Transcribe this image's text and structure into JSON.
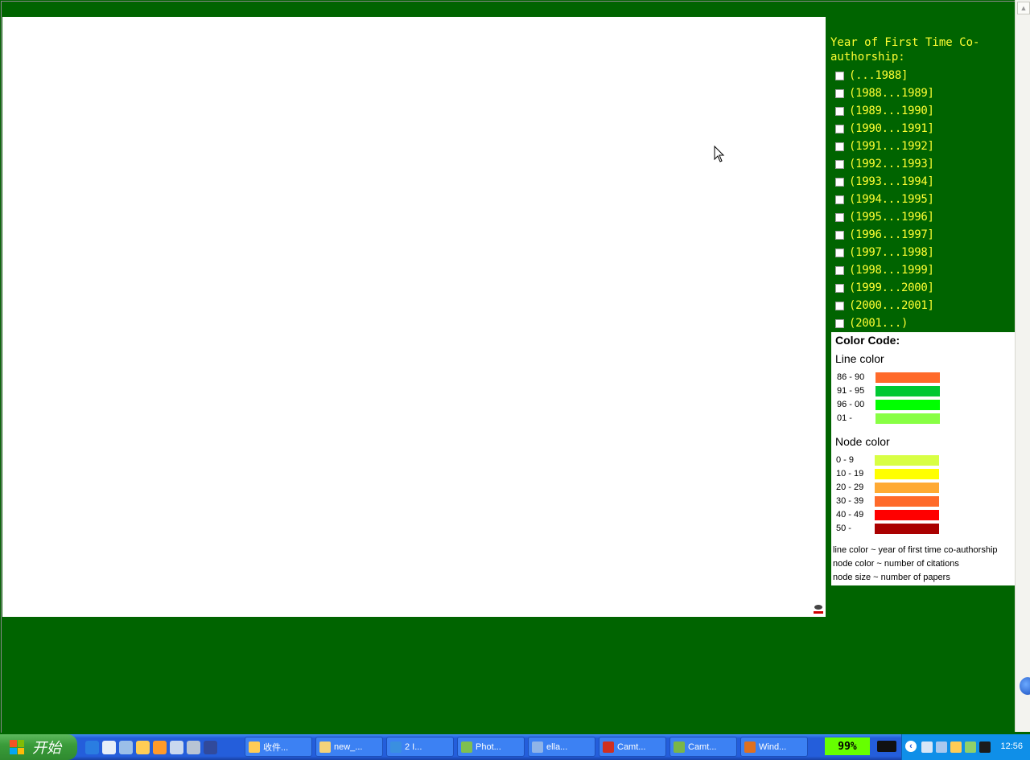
{
  "filter": {
    "title": "Year of First Time Co-authorship:",
    "years": [
      "(...1988]",
      "(1988...1989]",
      "(1989...1990]",
      "(1990...1991]",
      "(1991...1992]",
      "(1992...1993]",
      "(1993...1994]",
      "(1994...1995]",
      "(1995...1996]",
      "(1996...1997]",
      "(1997...1998]",
      "(1998...1999]",
      "(1999...2000]",
      "(2000...2001]",
      "(2001...)"
    ]
  },
  "legend": {
    "title": "Color Code:",
    "line_title": "Line color",
    "line_items": [
      {
        "label": "86 - 90",
        "color": "#ff6a2a"
      },
      {
        "label": "91 - 95",
        "color": "#00c832"
      },
      {
        "label": "96 - 00",
        "color": "#00ff00"
      },
      {
        "label": "01 -",
        "color": "#88ff44"
      }
    ],
    "node_title": "Node color",
    "node_items": [
      {
        "label": "0 - 9",
        "color": "#d8ff44"
      },
      {
        "label": "10 - 19",
        "color": "#ffff00"
      },
      {
        "label": "20 - 29",
        "color": "#ffaa33"
      },
      {
        "label": "30 - 39",
        "color": "#ff6a2a"
      },
      {
        "label": "40 - 49",
        "color": "#ff0000"
      },
      {
        "label": "50 -",
        "color": "#aa0000"
      }
    ],
    "notes": [
      "line color ~ year of first time co-authorship",
      "node color ~ number of citations",
      "node size ~ number of papers"
    ]
  },
  "taskbar": {
    "start_label": "开始",
    "tasks": [
      {
        "label": "收件...",
        "icon_color": "#ffcc55"
      },
      {
        "label": "new_...",
        "icon_color": "#f4d27a"
      },
      {
        "label": "2 I...",
        "icon_color": "#3a8fe0"
      },
      {
        "label": "Phot...",
        "icon_color": "#7fbf4f"
      },
      {
        "label": "ella...",
        "icon_color": "#8fb4e8"
      },
      {
        "label": "Camt...",
        "icon_color": "#d03020"
      },
      {
        "label": "Camt...",
        "icon_color": "#7ab648"
      },
      {
        "label": "Wind...",
        "icon_color": "#e07020"
      }
    ],
    "battery": "99%",
    "clock": "12:56"
  },
  "colors": {
    "background": "#006400",
    "filter_text": "#ffff33",
    "canvas": "#ffffff"
  }
}
